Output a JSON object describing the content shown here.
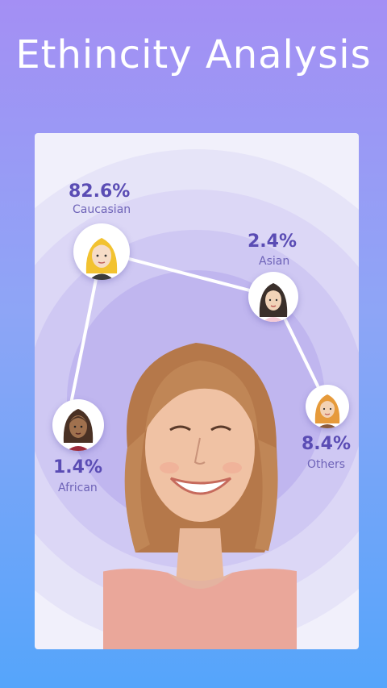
{
  "headline": "Ethincity Analysis",
  "nodes": [
    {
      "id": "caucasian",
      "percent": "82.6%",
      "label": "Caucasian"
    },
    {
      "id": "asian",
      "percent": "2.4%",
      "label": "Asian"
    },
    {
      "id": "others",
      "percent": "8.4%",
      "label": "Others"
    },
    {
      "id": "african",
      "percent": "1.4%",
      "label": "African"
    }
  ],
  "colors": {
    "bg_top": "#a48ff4",
    "bg_bottom": "#55a5fb",
    "percent": "#5a4cb4",
    "label": "#6e63b8",
    "line": "#ffffff"
  }
}
